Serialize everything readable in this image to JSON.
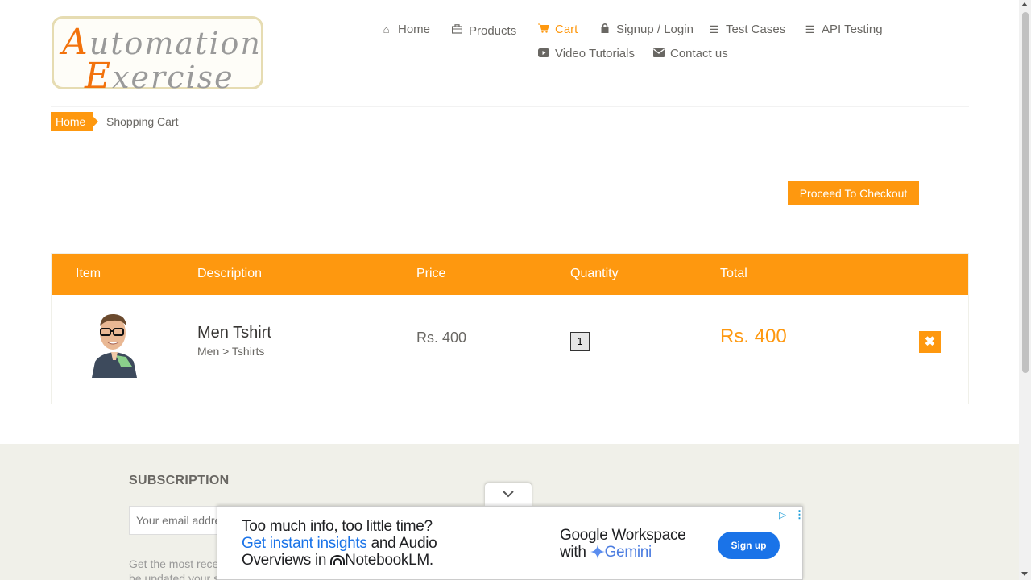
{
  "logo": {
    "line1_cap": "A",
    "line1_rest": "utomation",
    "line2_cap": "E",
    "line2_rest": "xercise"
  },
  "nav": {
    "home": "Home",
    "products": "Products",
    "cart": "Cart",
    "signup": "Signup / Login",
    "test_cases": "Test Cases",
    "api_testing": "API Testing",
    "video_tutorials": "Video Tutorials",
    "contact_us": "Contact us"
  },
  "breadcrumb": {
    "home": "Home",
    "current": "Shopping Cart"
  },
  "checkout_label": "Proceed To Checkout",
  "cart": {
    "headers": [
      "Item",
      "Description",
      "Price",
      "Quantity",
      "Total"
    ],
    "items": [
      {
        "name": "Men Tshirt",
        "category": "Men > Tshirts",
        "price": "Rs. 400",
        "quantity": "1",
        "total": "Rs. 400"
      }
    ]
  },
  "footer": {
    "subscription_title": "SUBSCRIPTION",
    "email_placeholder": "Your email address",
    "subscription_text": "Get the most recent updates from our site and be updated your self..."
  },
  "ad": {
    "line1": "Too much info, too little time?",
    "line2_highlight": "Get instant insights",
    "line2_rest": " and Audio",
    "line3": "Overviews in ",
    "line3_brand": "NotebookLM.",
    "brand_line1": "Google Workspace",
    "brand_line2_prefix": "with ",
    "brand_line2": "Gemini",
    "cta": "Sign up"
  },
  "colors": {
    "accent": "#fe980f",
    "ad_blue": "#1a73e8"
  }
}
